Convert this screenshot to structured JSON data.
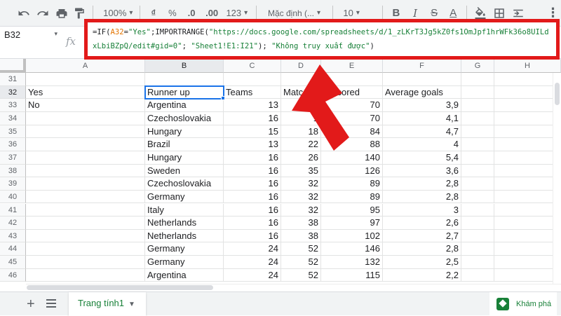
{
  "toolbar": {
    "zoom": "100%",
    "currency": "₫",
    "percent": "%",
    "dec_decrease": ".0",
    "dec_increase": ".00",
    "format_more": "123",
    "font": "Mặc định (...",
    "font_size": "10",
    "bold": "B",
    "italic": "I",
    "strike": "S",
    "text_color": "A"
  },
  "name_box": "B32",
  "formula_bar": {
    "fx_label": "fx",
    "parts": [
      "=IF(",
      "A32",
      "=",
      "\"Yes\"",
      ";IMPORTRANGE(",
      "\"https://docs.google.com/spreadsheets/d/1_zLKrT3Jg5kZ0fs1OmJpf1hrWFk36o8UILdxLbiBZpQ/edit#gid=0\"",
      "; ",
      "\"Sheet1!E1:I21\"",
      "); ",
      "\"Không truy xuất được\"",
      ")"
    ]
  },
  "columns": [
    "A",
    "B",
    "C",
    "D",
    "E",
    "F",
    "G",
    "H"
  ],
  "rows": [
    {
      "n": "31",
      "a": "",
      "b": "",
      "c": "",
      "d": "",
      "e": "",
      "f": ""
    },
    {
      "n": "32",
      "a": "Yes",
      "b": "Runner up",
      "c": "Teams",
      "d": "Matc",
      "e": "ls scored",
      "f": "Average goals"
    },
    {
      "n": "33",
      "a": "No",
      "b": "Argentina",
      "c": "13",
      "d": "",
      "e": "70",
      "f": "3,9"
    },
    {
      "n": "34",
      "a": "",
      "b": "Czechoslovakia",
      "c": "16",
      "d": "1",
      "e": "70",
      "f": "4,1"
    },
    {
      "n": "35",
      "a": "",
      "b": "Hungary",
      "c": "15",
      "d": "18",
      "e": "84",
      "f": "4,7"
    },
    {
      "n": "36",
      "a": "",
      "b": "Brazil",
      "c": "13",
      "d": "22",
      "e": "88",
      "f": "4"
    },
    {
      "n": "37",
      "a": "",
      "b": "Hungary",
      "c": "16",
      "d": "26",
      "e": "140",
      "f": "5,4"
    },
    {
      "n": "38",
      "a": "",
      "b": "Sweden",
      "c": "16",
      "d": "35",
      "e": "126",
      "f": "3,6"
    },
    {
      "n": "39",
      "a": "",
      "b": "Czechoslovakia",
      "c": "16",
      "d": "32",
      "e": "89",
      "f": "2,8"
    },
    {
      "n": "40",
      "a": "",
      "b": "Germany",
      "c": "16",
      "d": "32",
      "e": "89",
      "f": "2,8"
    },
    {
      "n": "41",
      "a": "",
      "b": "Italy",
      "c": "16",
      "d": "32",
      "e": "95",
      "f": "3"
    },
    {
      "n": "42",
      "a": "",
      "b": "Netherlands",
      "c": "16",
      "d": "38",
      "e": "97",
      "f": "2,6"
    },
    {
      "n": "43",
      "a": "",
      "b": "Netherlands",
      "c": "16",
      "d": "38",
      "e": "102",
      "f": "2,7"
    },
    {
      "n": "44",
      "a": "",
      "b": "Germany",
      "c": "24",
      "d": "52",
      "e": "146",
      "f": "2,8"
    },
    {
      "n": "45",
      "a": "",
      "b": "Germany",
      "c": "24",
      "d": "52",
      "e": "132",
      "f": "2,5"
    },
    {
      "n": "46",
      "a": "",
      "b": "Argentina",
      "c": "24",
      "d": "52",
      "e": "115",
      "f": "2,2"
    }
  ],
  "sheet_tab": "Trang tính1",
  "explore_label": "Khám phá",
  "colors": {
    "highlight": "#e21a1a",
    "selection": "#1a73e8",
    "sheets_green": "#188038"
  }
}
